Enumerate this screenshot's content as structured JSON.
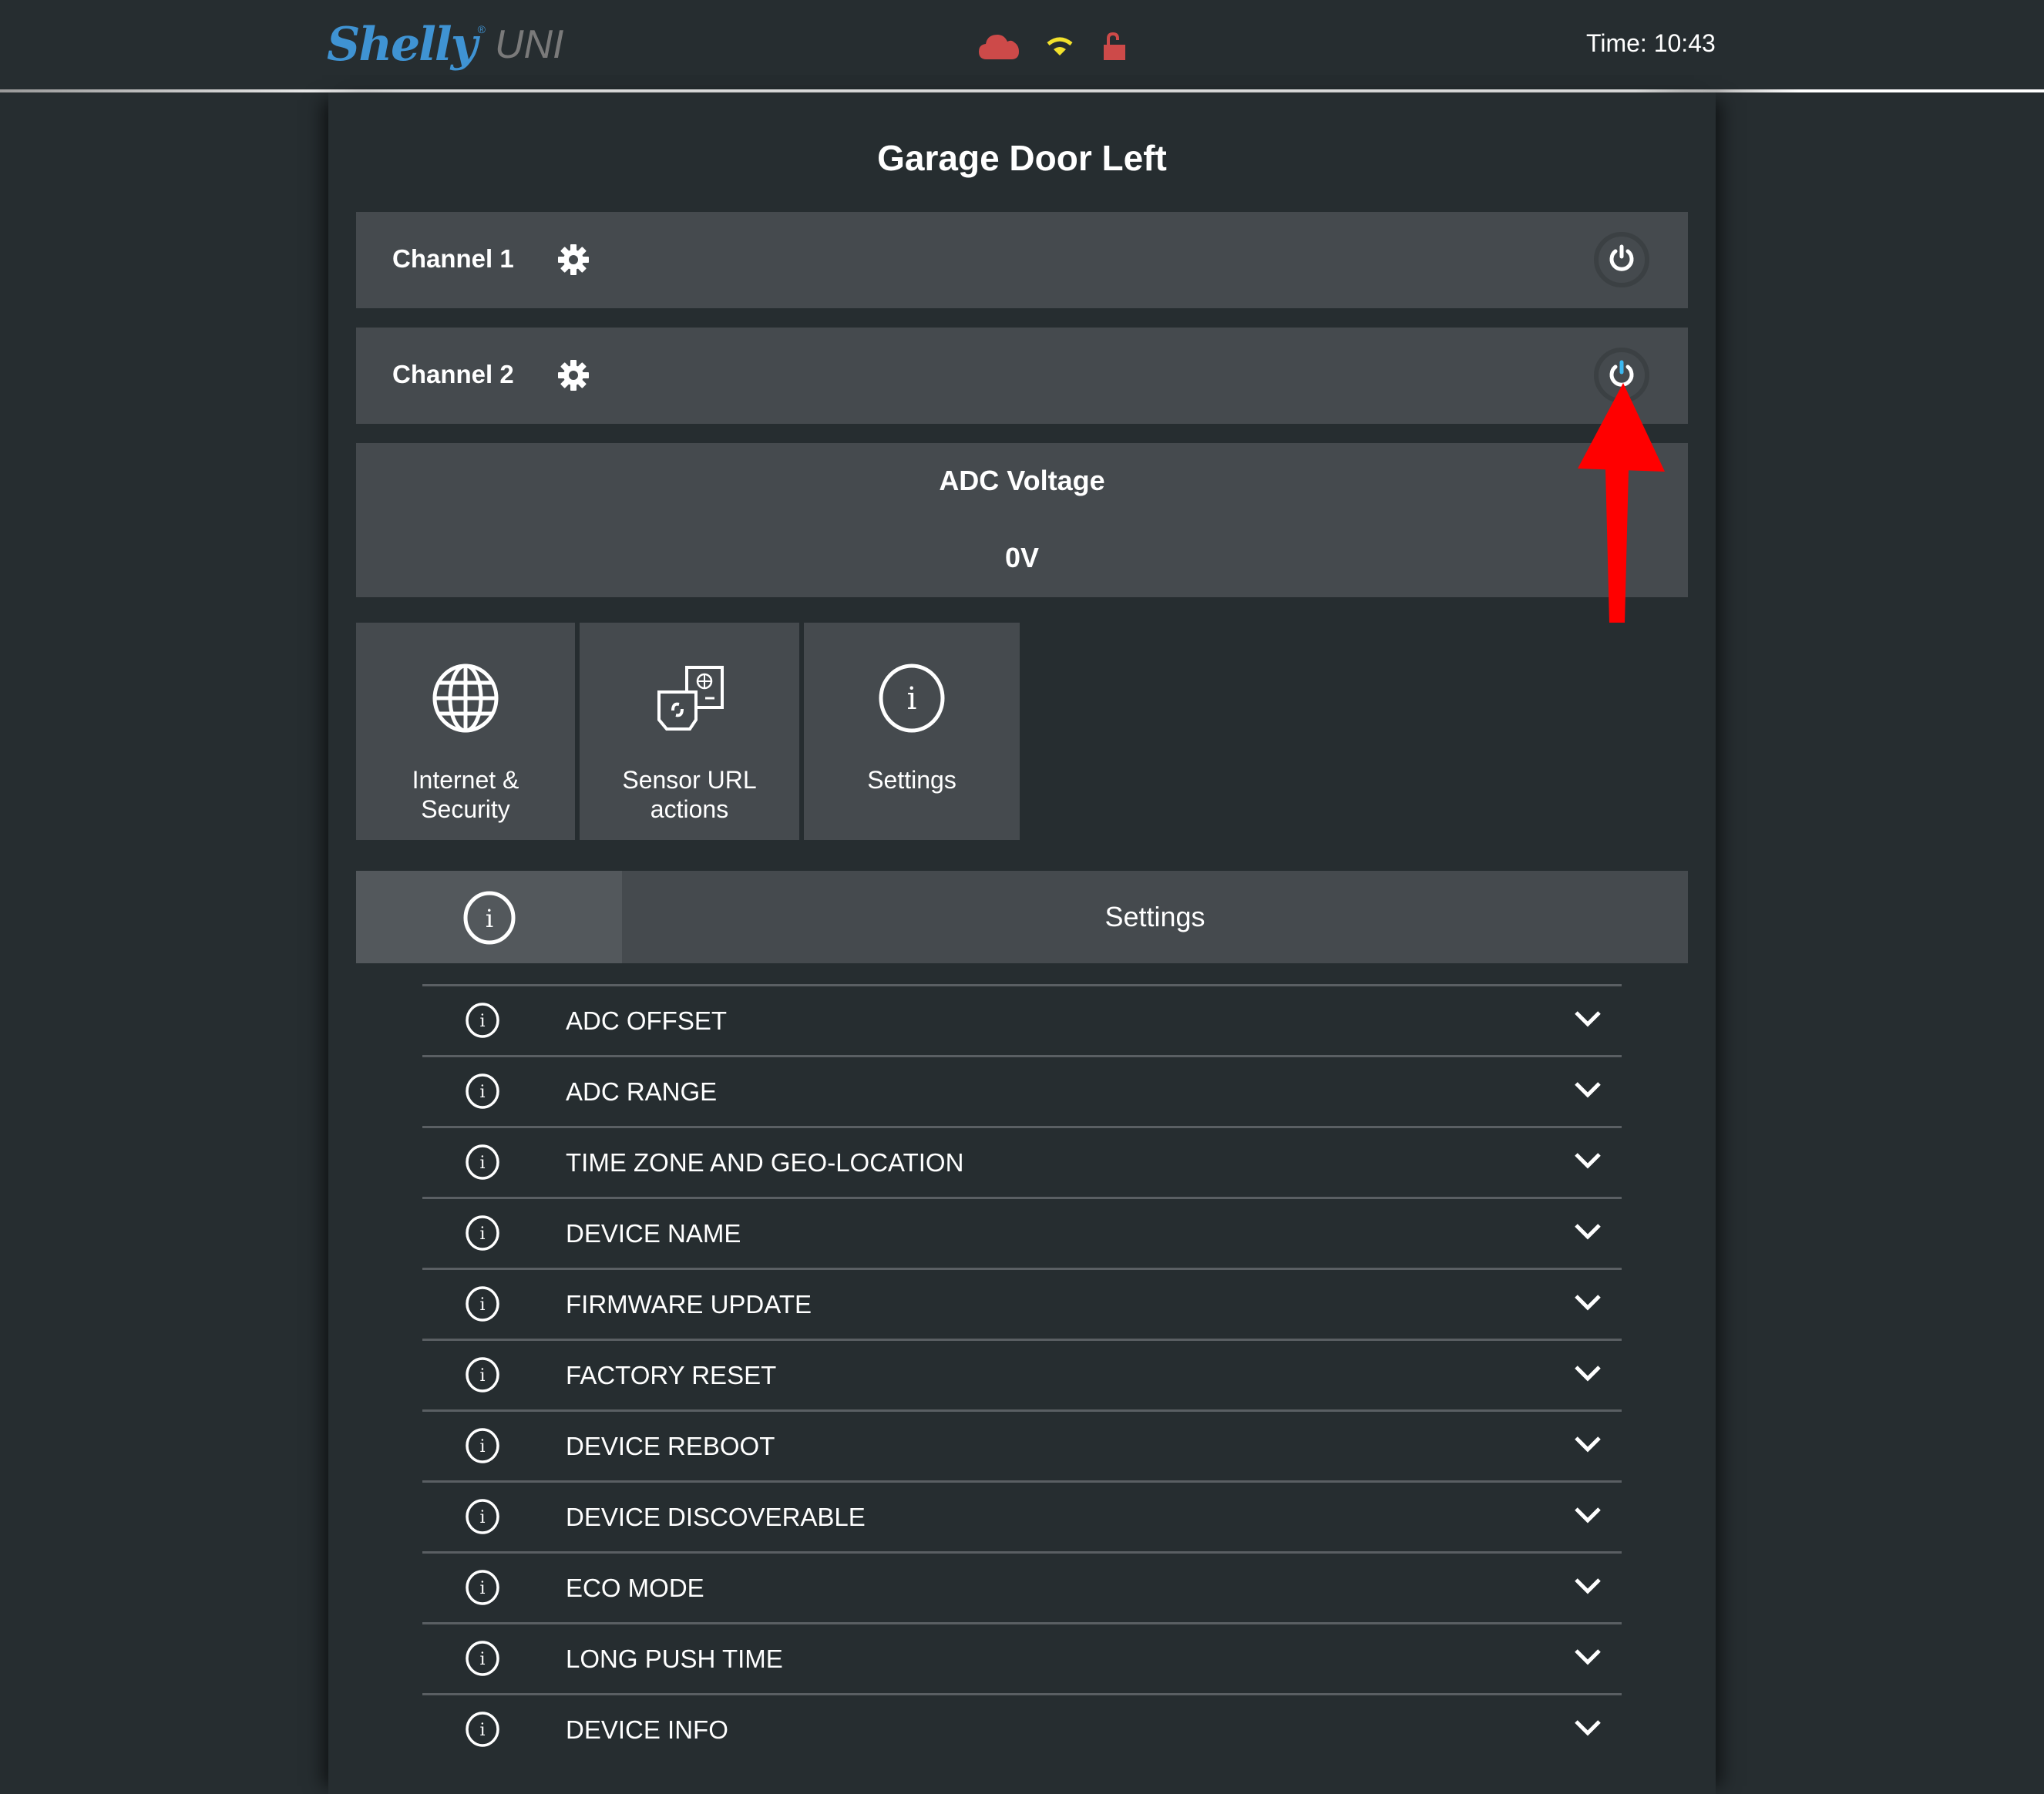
{
  "header": {
    "logo_brand": "Shelly",
    "logo_registered": "®",
    "logo_model": "UNI",
    "status_icons": [
      {
        "name": "cloud-icon",
        "color": "#cd4a49",
        "state": "disconnected"
      },
      {
        "name": "wifi-icon",
        "color": "#f2e12c",
        "state": "connected"
      },
      {
        "name": "unlocked-icon",
        "color": "#cd4a49",
        "state": "unlocked"
      }
    ],
    "time_label": "Time: 10:43"
  },
  "page": {
    "title": "Garage Door Left"
  },
  "channels": [
    {
      "label": "Channel 1",
      "power_on": false
    },
    {
      "label": "Channel 2",
      "power_on": true
    }
  ],
  "adc": {
    "title": "ADC Voltage",
    "value": "0V"
  },
  "tiles": [
    {
      "label_line1": "Internet &",
      "label_line2": "Security",
      "icon": "globe-icon"
    },
    {
      "label_line1": "Sensor URL",
      "label_line2": "actions",
      "icon": "sensor-url-icon"
    },
    {
      "label_line1": "Settings",
      "label_line2": "",
      "icon": "info-icon"
    }
  ],
  "settings": {
    "header_label": "Settings",
    "items": [
      "ADC OFFSET",
      "ADC RANGE",
      "TIME ZONE AND GEO-LOCATION",
      "DEVICE NAME",
      "FIRMWARE UPDATE",
      "FACTORY RESET",
      "DEVICE REBOOT",
      "DEVICE DISCOVERABLE",
      "ECO MODE",
      "LONG PUSH TIME",
      "DEVICE INFO"
    ]
  },
  "colors": {
    "brand_blue": "#3f93d3",
    "power_on_accent": "#3bb8f0",
    "annotation_arrow": "#ff0000"
  }
}
